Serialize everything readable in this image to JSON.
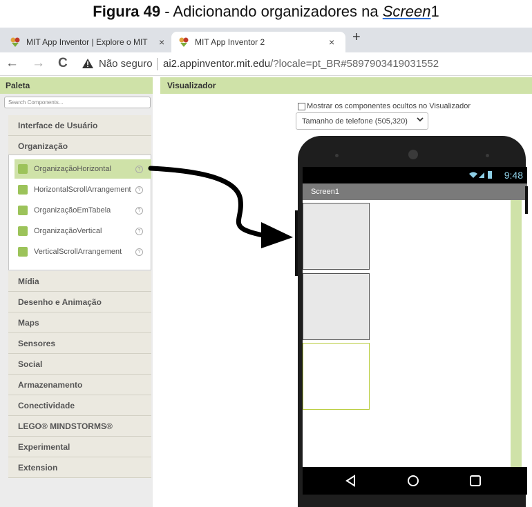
{
  "caption": {
    "bold": "Figura 49",
    "rest": " - Adicionando organizadores na ",
    "italic": "Screen",
    "tail": "1"
  },
  "browser": {
    "tabs": [
      {
        "title": "MIT App Inventor | Explore o MIT"
      },
      {
        "title": "MIT App Inventor 2"
      }
    ],
    "close_glyph": "×",
    "new_tab_glyph": "+",
    "nav": {
      "back": "←",
      "forward": "→",
      "reload": "C"
    },
    "security_text": "Não seguro",
    "url_host": "ai2.appinventor.mit.edu",
    "url_path": "/?locale=pt_BR#5897903419031552"
  },
  "palette": {
    "title": "Paleta",
    "search_placeholder": "Search Components...",
    "categories_top": [
      "Interface de Usuário",
      "Organização"
    ],
    "organizacao_items": [
      {
        "label": "OrganizaçãoHorizontal",
        "selected": true
      },
      {
        "label": "HorizontalScrollArrangement",
        "selected": false
      },
      {
        "label": "OrganizaçãoEmTabela",
        "selected": false
      },
      {
        "label": "OrganizaçãoVertical",
        "selected": false
      },
      {
        "label": "VerticalScrollArrangement",
        "selected": false
      }
    ],
    "help_glyph": "?",
    "categories_bottom": [
      "Mídia",
      "Desenho e Animação",
      "Maps",
      "Sensores",
      "Social",
      "Armazenamento",
      "Conectividade",
      "LEGO® MINDSTORMS®",
      "Experimental",
      "Extension"
    ]
  },
  "viewer": {
    "title": "Visualizador",
    "show_hidden_label": "Mostrar os componentes ocultos no Visualizador",
    "phone_size": "Tamanho de telefone (505,320)",
    "phone": {
      "time": "9:48",
      "screen_title": "Screen1"
    }
  },
  "colors": {
    "accent": "#cfe2a8",
    "status_text": "#8ecfe6",
    "arrangement_border_highlight": "#b8cc3a"
  }
}
